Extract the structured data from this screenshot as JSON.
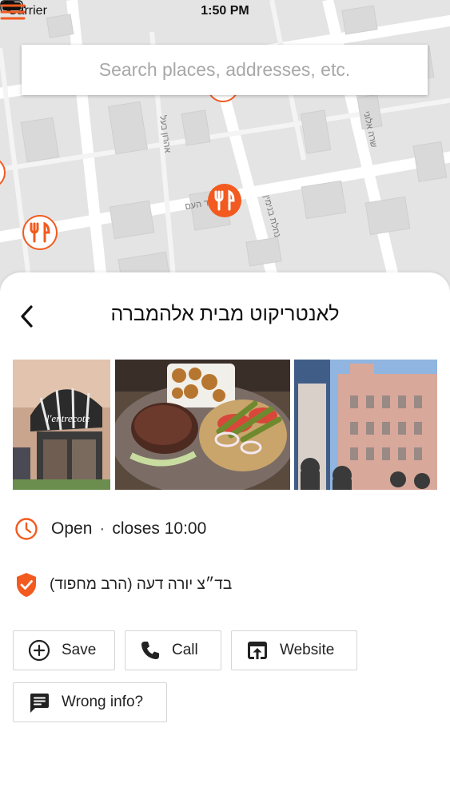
{
  "status_bar": {
    "carrier": "Carrier",
    "time": "1:50 PM"
  },
  "search": {
    "placeholder": "Search places, addresses, etc."
  },
  "map": {
    "street_labels": [
      "אחד העם",
      "אהרון בעל",
      "נחלת בנימין",
      "שרה אלוני"
    ],
    "marker_color": "#f25a1f"
  },
  "place": {
    "title": "לאנטריקוט מבית אלהמברה",
    "photo_sign_text": "l'entrecote",
    "status": "Open",
    "closes": "closes 10:00",
    "kosher": "בד״צ יורה דעה (הרב מחפוד)"
  },
  "actions": {
    "save": "Save",
    "call": "Call",
    "website": "Website",
    "wrong_info": "Wrong info?"
  },
  "colors": {
    "accent": "#f25a1f",
    "text": "#222222"
  }
}
